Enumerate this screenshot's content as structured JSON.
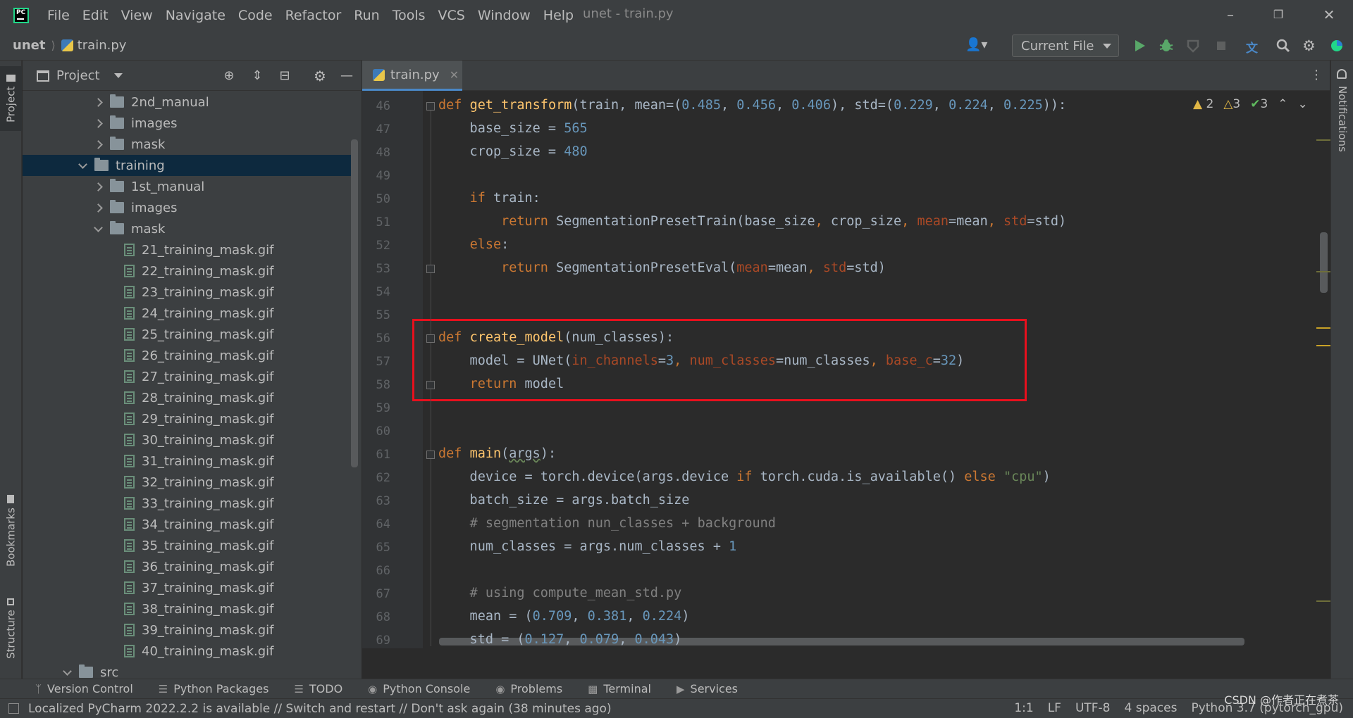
{
  "menu": [
    "File",
    "Edit",
    "View",
    "Navigate",
    "Code",
    "Refactor",
    "Run",
    "Tools",
    "VCS",
    "Window",
    "Help"
  ],
  "window_title": "unet - train.py",
  "breadcrumb": {
    "project": "unet",
    "file": "train.py"
  },
  "run_config": "Current File",
  "left_stripe": {
    "project": "Project",
    "bookmarks": "Bookmarks",
    "structure": "Structure"
  },
  "project_panel": {
    "title": "Project"
  },
  "tree": [
    {
      "label": "2nd_manual",
      "type": "folder",
      "state": "collapsed",
      "level": 3
    },
    {
      "label": "images",
      "type": "folder",
      "state": "collapsed",
      "level": 3
    },
    {
      "label": "mask",
      "type": "folder",
      "state": "collapsed",
      "level": 3
    },
    {
      "label": "training",
      "type": "folder",
      "state": "expanded",
      "level": 2,
      "selected": true
    },
    {
      "label": "1st_manual",
      "type": "folder",
      "state": "collapsed",
      "level": 3
    },
    {
      "label": "images",
      "type": "folder",
      "state": "collapsed",
      "level": 3
    },
    {
      "label": "mask",
      "type": "folder",
      "state": "expanded",
      "level": 3
    },
    {
      "label": "21_training_mask.gif",
      "type": "file",
      "level": 4
    },
    {
      "label": "22_training_mask.gif",
      "type": "file",
      "level": 4
    },
    {
      "label": "23_training_mask.gif",
      "type": "file",
      "level": 4
    },
    {
      "label": "24_training_mask.gif",
      "type": "file",
      "level": 4
    },
    {
      "label": "25_training_mask.gif",
      "type": "file",
      "level": 4
    },
    {
      "label": "26_training_mask.gif",
      "type": "file",
      "level": 4
    },
    {
      "label": "27_training_mask.gif",
      "type": "file",
      "level": 4
    },
    {
      "label": "28_training_mask.gif",
      "type": "file",
      "level": 4
    },
    {
      "label": "29_training_mask.gif",
      "type": "file",
      "level": 4
    },
    {
      "label": "30_training_mask.gif",
      "type": "file",
      "level": 4
    },
    {
      "label": "31_training_mask.gif",
      "type": "file",
      "level": 4
    },
    {
      "label": "32_training_mask.gif",
      "type": "file",
      "level": 4
    },
    {
      "label": "33_training_mask.gif",
      "type": "file",
      "level": 4
    },
    {
      "label": "34_training_mask.gif",
      "type": "file",
      "level": 4
    },
    {
      "label": "35_training_mask.gif",
      "type": "file",
      "level": 4
    },
    {
      "label": "36_training_mask.gif",
      "type": "file",
      "level": 4
    },
    {
      "label": "37_training_mask.gif",
      "type": "file",
      "level": 4
    },
    {
      "label": "38_training_mask.gif",
      "type": "file",
      "level": 4
    },
    {
      "label": "39_training_mask.gif",
      "type": "file",
      "level": 4
    },
    {
      "label": "40_training_mask.gif",
      "type": "file",
      "level": 4
    },
    {
      "label": "src",
      "type": "folder",
      "state": "expanded",
      "level": 1
    }
  ],
  "editor_tab": "train.py",
  "inspections": {
    "warn1": "2",
    "warn2": "3",
    "ok": "3"
  },
  "code": [
    {
      "n": "46",
      "html": "<span class=\"kw\">def </span><span class=\"fn\">get_transform</span>(train, mean=(<span class=\"num\">0.485</span>, <span class=\"num\">0.456</span>, <span class=\"num\">0.406</span>), std=(<span class=\"num\">0.229</span>, <span class=\"num\">0.224</span>, <span class=\"num\">0.225</span>)):"
    },
    {
      "n": "47",
      "html": "    base_size = <span class=\"num\">565</span>"
    },
    {
      "n": "48",
      "html": "    crop_size = <span class=\"num\">480</span>"
    },
    {
      "n": "49",
      "html": ""
    },
    {
      "n": "50",
      "html": "    <span class=\"kw\">if </span>train:"
    },
    {
      "n": "51",
      "html": "        <span class=\"kw\">return </span>SegmentationPresetTrain(base_size<span class=\"kw\">, </span>crop_size<span class=\"kw\">, </span><span class=\"param\">mean</span>=mean<span class=\"kw\">, </span><span class=\"param\">std</span>=std)"
    },
    {
      "n": "52",
      "html": "    <span class=\"kw\">else</span>:"
    },
    {
      "n": "53",
      "html": "        <span class=\"kw\">return </span>SegmentationPresetEval(<span class=\"param\">mean</span>=mean<span class=\"kw\">, </span><span class=\"param\">std</span>=std)"
    },
    {
      "n": "54",
      "html": ""
    },
    {
      "n": "55",
      "html": ""
    },
    {
      "n": "56",
      "html": "<span class=\"kw\">def </span><span class=\"fn\">create_model</span>(num_classes):"
    },
    {
      "n": "57",
      "html": "    model = UNet(<span class=\"param\">in_channels</span>=<span class=\"num\">3</span><span class=\"kw\">, </span><span class=\"param\">num_classes</span>=num_classes<span class=\"kw\">, </span><span class=\"param\">base_c</span>=<span class=\"num\">32</span>)"
    },
    {
      "n": "58",
      "html": "    <span class=\"kw\">return </span>model"
    },
    {
      "n": "59",
      "html": ""
    },
    {
      "n": "60",
      "html": ""
    },
    {
      "n": "61",
      "html": "<span class=\"kw\">def </span><span class=\"fn\">main</span>(<span class=\"und\">args</span>):"
    },
    {
      "n": "62",
      "html": "    device = torch.device(args.device <span class=\"kw\">if </span>torch.cuda.is_available() <span class=\"kw\">else </span><span class=\"str\">\"cpu\"</span>)"
    },
    {
      "n": "63",
      "html": "    batch_size = args.batch_size"
    },
    {
      "n": "64",
      "html": "    <span class=\"cm\"># segmentation nun_classes + background</span>"
    },
    {
      "n": "65",
      "html": "    num_classes = args.num_classes + <span class=\"num\">1</span>"
    },
    {
      "n": "66",
      "html": ""
    },
    {
      "n": "67",
      "html": "    <span class=\"cm\"># using compute_mean_std.py</span>"
    },
    {
      "n": "68",
      "html": "    mean = (<span class=\"num\">0.709</span>, <span class=\"num\">0.381</span>, <span class=\"num\">0.224</span>)"
    },
    {
      "n": "69",
      "html": "    std = (<span class=\"num\">0.127</span>, <span class=\"num\">0.079</span>, <span class=\"num\">0.043</span>)"
    }
  ],
  "notifications_label": "Notifications",
  "toolwindows": [
    {
      "label": "Version Control",
      "icon": "branch-icon"
    },
    {
      "label": "Python Packages",
      "icon": "packages-icon"
    },
    {
      "label": "TODO",
      "icon": "list-icon"
    },
    {
      "label": "Python Console",
      "icon": "console-icon"
    },
    {
      "label": "Problems",
      "icon": "problems-icon"
    },
    {
      "label": "Terminal",
      "icon": "terminal-icon"
    },
    {
      "label": "Services",
      "icon": "services-icon"
    }
  ],
  "status": {
    "message": "Localized PyCharm 2022.2.2 is available // Switch and restart // Don't ask again (38 minutes ago)",
    "position": "1:1",
    "line_sep": "LF",
    "encoding": "UTF-8",
    "indent": "4 spaces",
    "interpreter": "Python 3.7 (pytorch_gpu)",
    "watermark": "CSDN @作者正在煮茶"
  },
  "colors": {
    "accent": "#4a88c7",
    "highlight_box": "#e8101d",
    "keyword": "#cc7832",
    "function": "#ffc66d",
    "number": "#6897bb"
  }
}
